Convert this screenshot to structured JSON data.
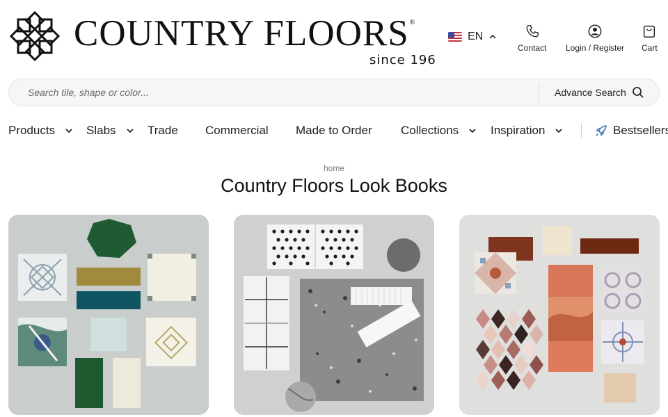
{
  "brand": {
    "name": "COUNTRY FLOORS",
    "registered_mark": "®",
    "tagline": "since 196"
  },
  "language": {
    "code": "EN",
    "flag": "us-flag-icon"
  },
  "utility_nav": {
    "contact_label": "Contact",
    "login_label": "Login / Register",
    "cart_label": "Cart"
  },
  "search": {
    "placeholder": "Search tile, shape or color...",
    "advance_label": "Advance Search"
  },
  "main_nav": [
    {
      "label": "Products",
      "has_dropdown": true
    },
    {
      "label": "Slabs",
      "has_dropdown": true
    },
    {
      "label": "Trade",
      "has_dropdown": false
    },
    {
      "label": "Commercial",
      "has_dropdown": false
    },
    {
      "label": "Made to Order",
      "has_dropdown": false
    },
    {
      "label": "Collections",
      "has_dropdown": true
    },
    {
      "label": "Inspiration",
      "has_dropdown": true
    },
    {
      "label": "Bestsellers",
      "icon": "rocket-icon"
    }
  ],
  "breadcrumb": {
    "home": "home"
  },
  "page": {
    "title": "Country Floors Look Books"
  },
  "lookbooks": [
    {
      "image": "tile-sample-flatlay-green-patterned"
    },
    {
      "image": "tile-sample-flatlay-terrazzo-dots"
    },
    {
      "image": "tile-sample-flatlay-terracotta-harlequin"
    }
  ],
  "colors": {
    "text": "#1d1d1d",
    "search_bg": "#f6f6f6",
    "card_bg_1": "#c9cdcc",
    "card_bg_2": "#d0d0ce",
    "card_bg_3": "#dfdfdd"
  }
}
